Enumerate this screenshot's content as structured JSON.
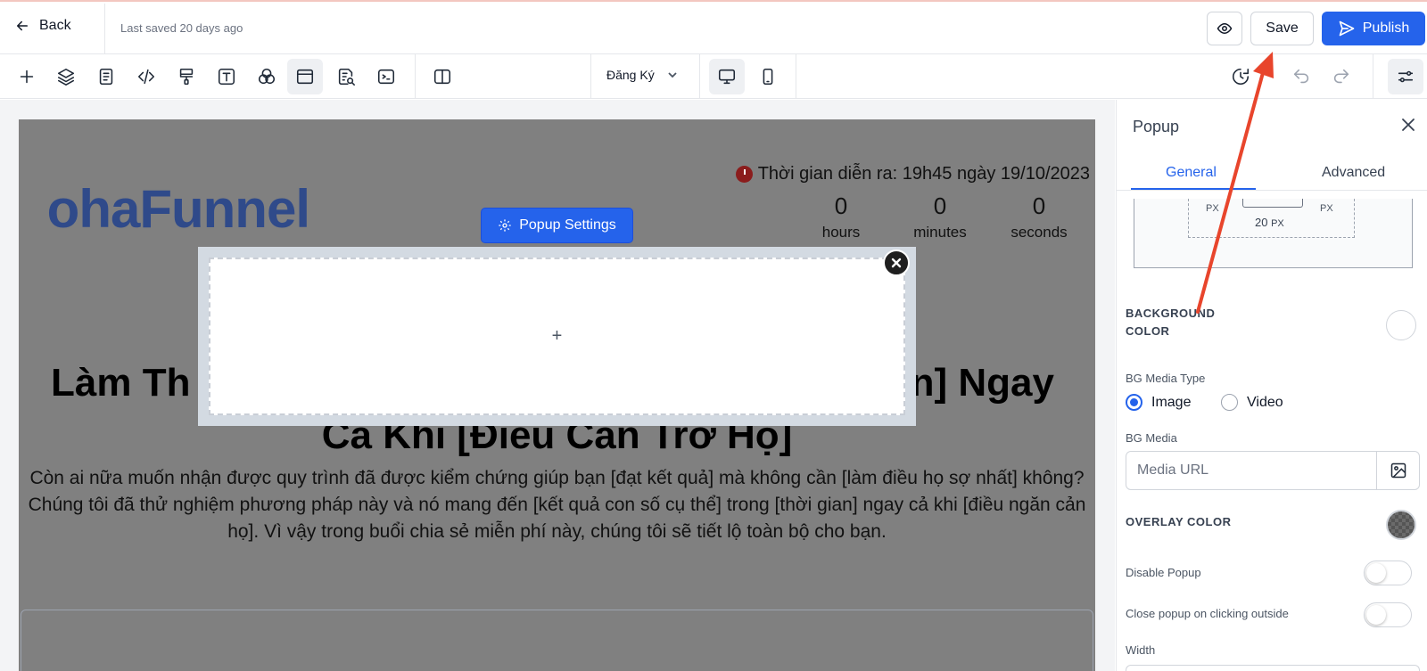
{
  "topbar": {
    "back_label": "Back",
    "saved_text": "Last saved 20 days ago",
    "save_label": "Save",
    "publish_label": "Publish"
  },
  "toolbar": {
    "tools": [
      "plus-icon",
      "layers-icon",
      "page-icon",
      "code-icon",
      "paint-roller-icon",
      "text-box-icon",
      "color-circles-icon",
      "popup-layout-icon",
      "form-search-icon",
      "terminal-icon",
      "split-view-icon"
    ],
    "page_select": "Đăng Ký",
    "devices": [
      "desktop-icon",
      "mobile-icon"
    ],
    "right_tools": [
      "history-icon",
      "undo-icon",
      "redo-icon",
      "settings-sliders-icon"
    ]
  },
  "canvas": {
    "logo_text": "ohaFunnel",
    "event_time": "Thời gian diễn ra: 19h45 ngày 19/10/2023",
    "countdown": [
      {
        "value": "0",
        "unit": "hours"
      },
      {
        "value": "0",
        "unit": "minutes"
      },
      {
        "value": "0",
        "unit": "seconds"
      }
    ],
    "headline_line1_left": "Làm Th",
    "headline_line1_right": "n] Ngay",
    "headline_line2": "Cả Khi [Điều Cản Trở Họ]",
    "subtext": "Còn ai nữa muốn nhận được quy trình đã được kiểm chứng giúp bạn [đạt kết quả] mà không cần [làm điều họ sợ nhất] không? Chúng tôi đã thử nghiệm phương pháp này và nó mang đến [kết quả con số cụ thể] trong [thời gian] ngay cả khi [điều ngăn cản họ]. Vì vậy trong buổi chia sẻ miễn phí này, chúng tôi sẽ tiết lộ toàn bộ cho bạn.",
    "popup_settings_label": "Popup Settings",
    "popup_add": "+"
  },
  "panel": {
    "title": "Popup",
    "tabs": [
      "General",
      "Advanced"
    ],
    "active_tab": "General",
    "spacing": {
      "left_unit": "PX",
      "right_unit": "PX",
      "bottom_value": "20",
      "bottom_unit": "PX"
    },
    "background_color_label": "BACKGROUND COLOR",
    "bg_media_type_label": "BG Media Type",
    "bg_media_type_options": [
      "Image",
      "Video"
    ],
    "bg_media_type_selected": "Image",
    "bg_media_label": "BG Media",
    "bg_media_placeholder": "Media URL",
    "overlay_color_label": "OVERLAY COLOR",
    "disable_popup_label": "Disable Popup",
    "disable_popup_on": false,
    "close_outside_label": "Close popup on clicking outside",
    "close_outside_on": false,
    "width_label": "Width"
  },
  "colors": {
    "accent": "#2563eb",
    "canvas_overlay": "#808080",
    "logo": "#2f4a8a",
    "annotation_arrow": "#e8452c"
  }
}
